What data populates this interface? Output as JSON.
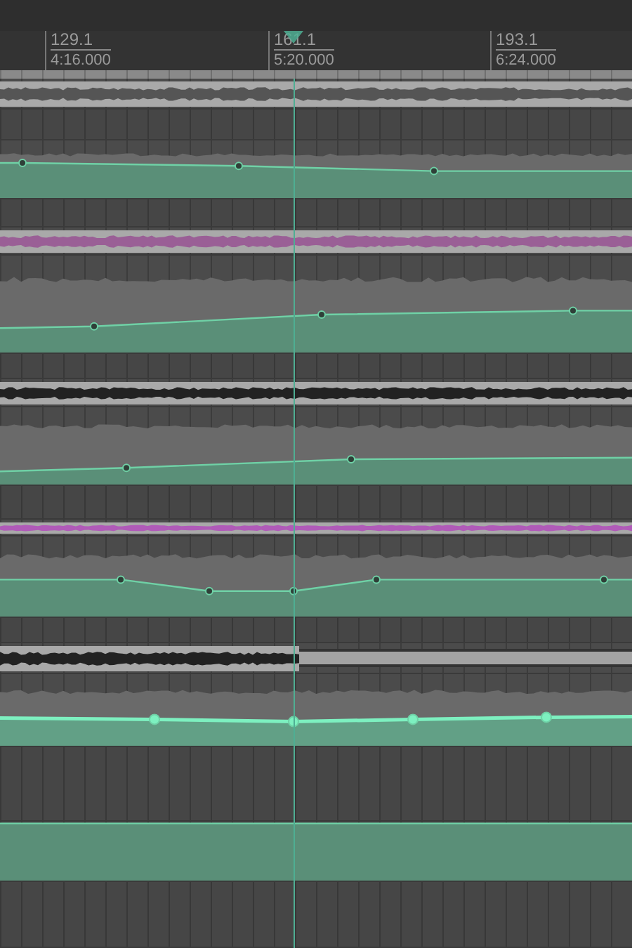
{
  "ruler": {
    "markers": [
      {
        "bar": "129.1",
        "time": "4:16.000"
      },
      {
        "bar": "161.1",
        "time": "5:20.000"
      },
      {
        "bar": "193.1",
        "time": "6:24.000"
      }
    ]
  },
  "tracks": [
    {
      "kind": "region",
      "color": "#555555",
      "ends_at_playhead": false
    },
    {
      "kind": "empty"
    },
    {
      "kind": "automation",
      "selected": false
    },
    {
      "kind": "empty"
    },
    {
      "kind": "region",
      "color": "#9a5f96",
      "ends_at_playhead": false
    },
    {
      "kind": "automation",
      "selected": false
    },
    {
      "kind": "empty"
    },
    {
      "kind": "region",
      "color": "#222222",
      "ends_at_playhead": false
    },
    {
      "kind": "automation",
      "selected": false
    },
    {
      "kind": "empty"
    },
    {
      "kind": "region",
      "color": "#b05ab8",
      "ends_at_playhead": false
    },
    {
      "kind": "automation",
      "selected": false
    },
    {
      "kind": "empty"
    },
    {
      "kind": "region",
      "color": "#222222",
      "ends_at_playhead": true
    },
    {
      "kind": "automation",
      "selected": true
    },
    {
      "kind": "empty"
    },
    {
      "kind": "automation",
      "selected": false
    },
    {
      "kind": "empty"
    }
  ]
}
